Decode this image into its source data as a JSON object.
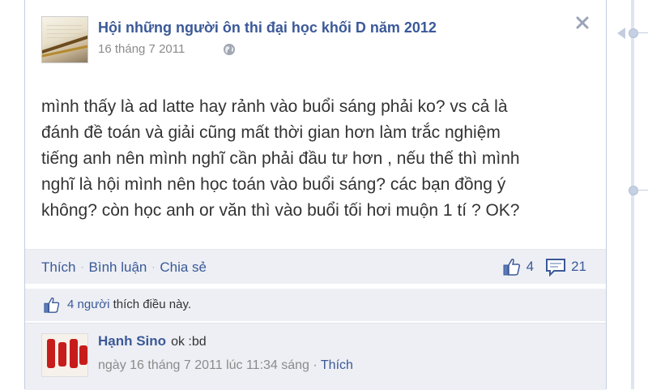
{
  "post": {
    "group_name": "Hội những người ôn thi đại học khối D năm 2012",
    "date": "16 tháng 7 2011",
    "body_lines": [
      "mình thấy là ad latte hay rảnh vào buổi sáng phải ko? vs cả là",
      "đánh đề toán và giải cũng mất thời gian hơn làm trắc nghiệm",
      "tiếng anh nên mình nghĩ cần phải đầu tư hơn , nếu thế thì mình",
      "nghĩ là hội mình nên học toán vào buổi sáng? các bạn đồng ý",
      "không? còn học anh or văn thì vào buổi tối hơi muộn 1 tí ? OK?"
    ]
  },
  "actions": {
    "like_label": "Thích",
    "comment_label": "Bình luận",
    "share_label": "Chia sẻ",
    "separator": "·",
    "like_count": "4",
    "comment_count": "21"
  },
  "likes": {
    "people_link": "4 người",
    "suffix": " thích điều này."
  },
  "comment": {
    "author": "Hạnh Sino",
    "text": "ok :bd",
    "timestamp": "ngày 16 tháng 7 2011 lúc 11:34 sáng",
    "separator": " · ",
    "like_label": "Thích"
  },
  "colors": {
    "link": "#3b5998",
    "bar_bg": "#edeff4",
    "meta": "#8b8b8b"
  },
  "icons": [
    "globe-icon",
    "close-icon",
    "like-thumb-icon",
    "comment-bubble-icon",
    "timeline-dot-icon"
  ]
}
